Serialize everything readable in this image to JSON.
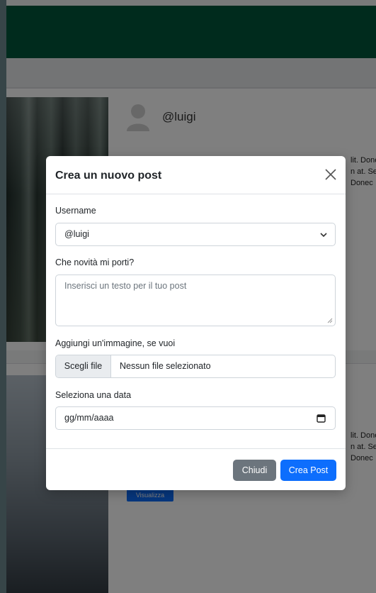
{
  "background": {
    "post1": {
      "username": "@luigi",
      "text_lines": [
        "lit. Donec",
        "n at. Sed",
        "Donec"
      ]
    },
    "post2": {
      "text_lines": [
        "lit. Donec",
        "n at. Sed",
        "Donec"
      ],
      "view_label": "Visualizza"
    }
  },
  "modal": {
    "title": "Crea un nuovo post",
    "username_label": "Username",
    "username_value": "@luigi",
    "text_label": "Che novità mi porti?",
    "text_placeholder": "Inserisci un testo per il tuo post",
    "image_label": "Aggiungi un'immagine, se vuoi",
    "file_button": "Scegli file",
    "file_status": "Nessun file selezionato",
    "date_label": "Seleziona una data",
    "date_placeholder": "gg/mm/aaaa",
    "close_button": "Chiudi",
    "create_button": "Crea Post"
  },
  "colors": {
    "navbar": "#00573a",
    "primary": "#0d6efd",
    "secondary": "#6c757d"
  },
  "icons": [
    "avatar-icon",
    "close-icon",
    "chevron-down-icon",
    "calendar-icon",
    "resize-grip-icon"
  ]
}
